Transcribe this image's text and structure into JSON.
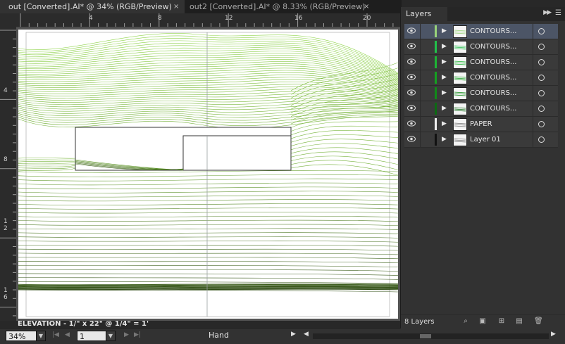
{
  "tabs": [
    {
      "label": "out [Converted].AI* @ 34% (RGB/Preview)",
      "active": true,
      "close": "×"
    },
    {
      "label": "out2 [Converted].AI* @ 8.33% (RGB/Preview)",
      "active": false,
      "close": "×"
    }
  ],
  "ruler_top": [
    "4",
    "8",
    "12",
    "16",
    "20"
  ],
  "ruler_left": [
    "4",
    "8",
    "1\n2",
    "1\n6"
  ],
  "artboard_label": "ELEVATION - 1/\" x 22\" @ 1/4\" = 1'",
  "status": {
    "zoom": "34%",
    "artboard_number": "1",
    "tool": "Hand"
  },
  "layers_panel": {
    "tab_label": "Layers",
    "layer_count": "8 Layers",
    "layers": [
      {
        "name": "CONTOURS...",
        "color": "#99d47a",
        "selected": true
      },
      {
        "name": "CONTOURS...",
        "color": "#22c04a",
        "selected": false
      },
      {
        "name": "CONTOURS...",
        "color": "#1db534",
        "selected": false
      },
      {
        "name": "CONTOURS...",
        "color": "#14a020",
        "selected": false
      },
      {
        "name": "CONTOURS...",
        "color": "#108a18",
        "selected": false
      },
      {
        "name": "CONTOURS...",
        "color": "#0c6a12",
        "selected": false
      },
      {
        "name": "PAPER",
        "color": "#f0f0f0",
        "selected": false
      },
      {
        "name": "Layer 01",
        "color": "#111111",
        "selected": false
      }
    ]
  },
  "colors": {
    "contour_light": "#8fd44a",
    "contour_dark": "#2e4a14",
    "selection": "#4c5566"
  }
}
